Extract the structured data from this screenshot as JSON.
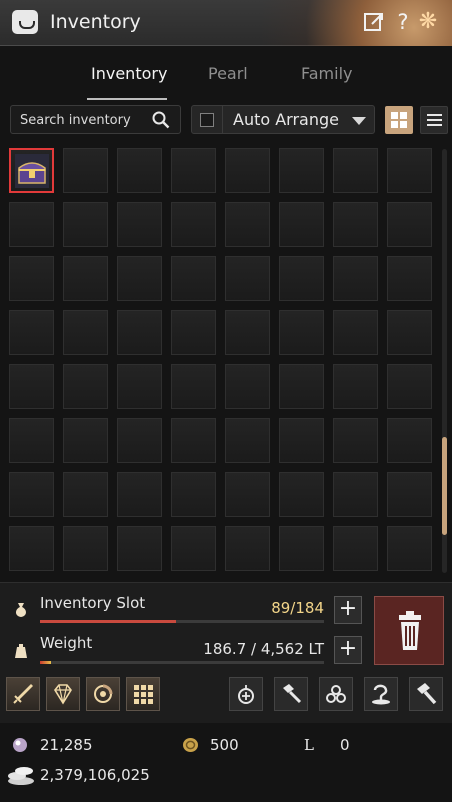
{
  "window": {
    "title": "Inventory"
  },
  "tabs": [
    {
      "label": "Inventory"
    },
    {
      "label": "Pearl"
    },
    {
      "label": "Family"
    }
  ],
  "search": {
    "placeholder": "Search inventory"
  },
  "auto_arrange": {
    "label": "Auto Arrange",
    "checked": false
  },
  "grid": {
    "columns": 8,
    "rows": 8,
    "items": [
      {
        "slot": 0,
        "icon": "treasure-chest-icon"
      }
    ],
    "scroll_position": 0.7
  },
  "inventory_slot": {
    "label": "Inventory Slot",
    "value": "89/184",
    "fill": 0.48
  },
  "weight": {
    "label": "Weight",
    "value": "186.7 / 4,562 LT",
    "fill": 0.04
  },
  "currency": {
    "pearls": "21,285",
    "coins": "500",
    "loyalty_symbol": "L",
    "loyalty": "0",
    "silver": "2,379,106,025"
  },
  "colors": {
    "accent": "#c8a47d",
    "selected_border": "#e23a3a",
    "trash": "#5a2522",
    "slot_value": "#f2d58a"
  }
}
